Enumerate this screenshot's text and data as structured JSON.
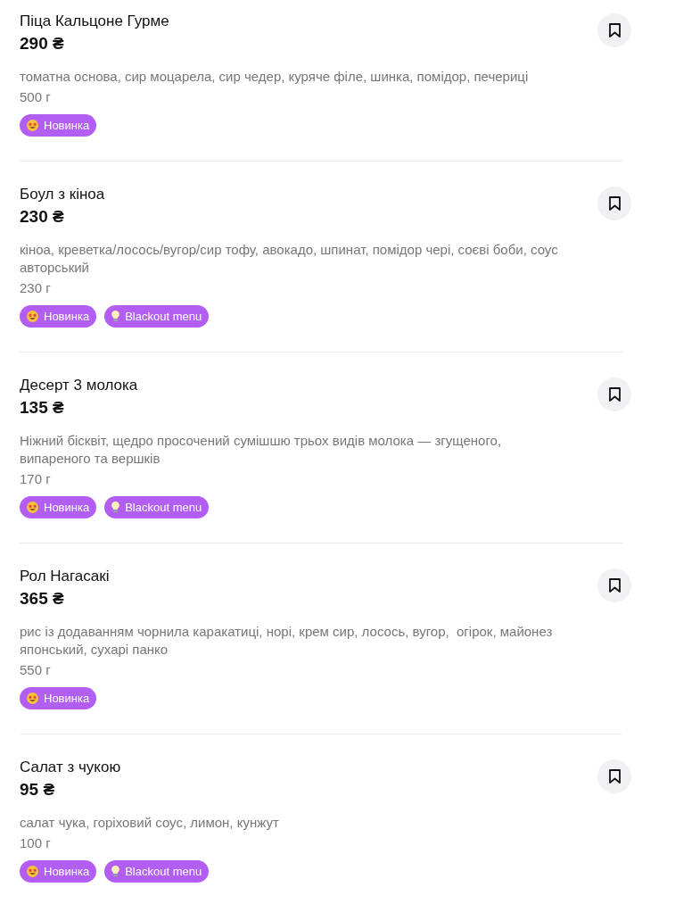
{
  "items": [
    {
      "name": "Піца Кальцоне Гурме",
      "price": "290 ₴",
      "description": "томатна основа, сир моцарела, сир чедер, куряче філе, шинка, помідор, печериці",
      "weight": "500 г",
      "tags": [
        {
          "kind": "new",
          "label": "Новинка"
        }
      ],
      "saved": false
    },
    {
      "name": "Боул з кіноа",
      "price": "230 ₴",
      "description": "кіноа, креветка/лосось/вугор/сир тофу, авокадо, шпинат, помідор чері, соєві боби, соус авторський",
      "weight": "230 г",
      "tags": [
        {
          "kind": "new",
          "label": "Новинка"
        },
        {
          "kind": "blackout",
          "label": "Blackout menu"
        }
      ],
      "saved": false
    },
    {
      "name": "Десерт 3 молока",
      "price": "135 ₴",
      "description": "Ніжний бісквіт, щедро просочений сумішшю трьох видів молока — згущеного, випареного та вершків",
      "weight": "170 г",
      "tags": [
        {
          "kind": "new",
          "label": "Новинка"
        },
        {
          "kind": "blackout",
          "label": "Blackout menu"
        }
      ],
      "saved": false
    },
    {
      "name": "Рол Нагасакі",
      "price": "365 ₴",
      "description": "рис із додаванням чорнила каракатиці, норі, крем сир, лосось, вугор,  огірок, майонез японський, сухарі панко",
      "weight": "550 г",
      "tags": [
        {
          "kind": "new",
          "label": "Новинка"
        }
      ],
      "saved": false
    },
    {
      "name": "Салат з чукою",
      "price": "95 ₴",
      "description": "салат чука, горіховий соус, лимон, кунжут",
      "weight": "100 г",
      "tags": [
        {
          "kind": "new",
          "label": "Новинка"
        },
        {
          "kind": "blackout",
          "label": "Blackout menu"
        }
      ],
      "saved": false
    }
  ]
}
